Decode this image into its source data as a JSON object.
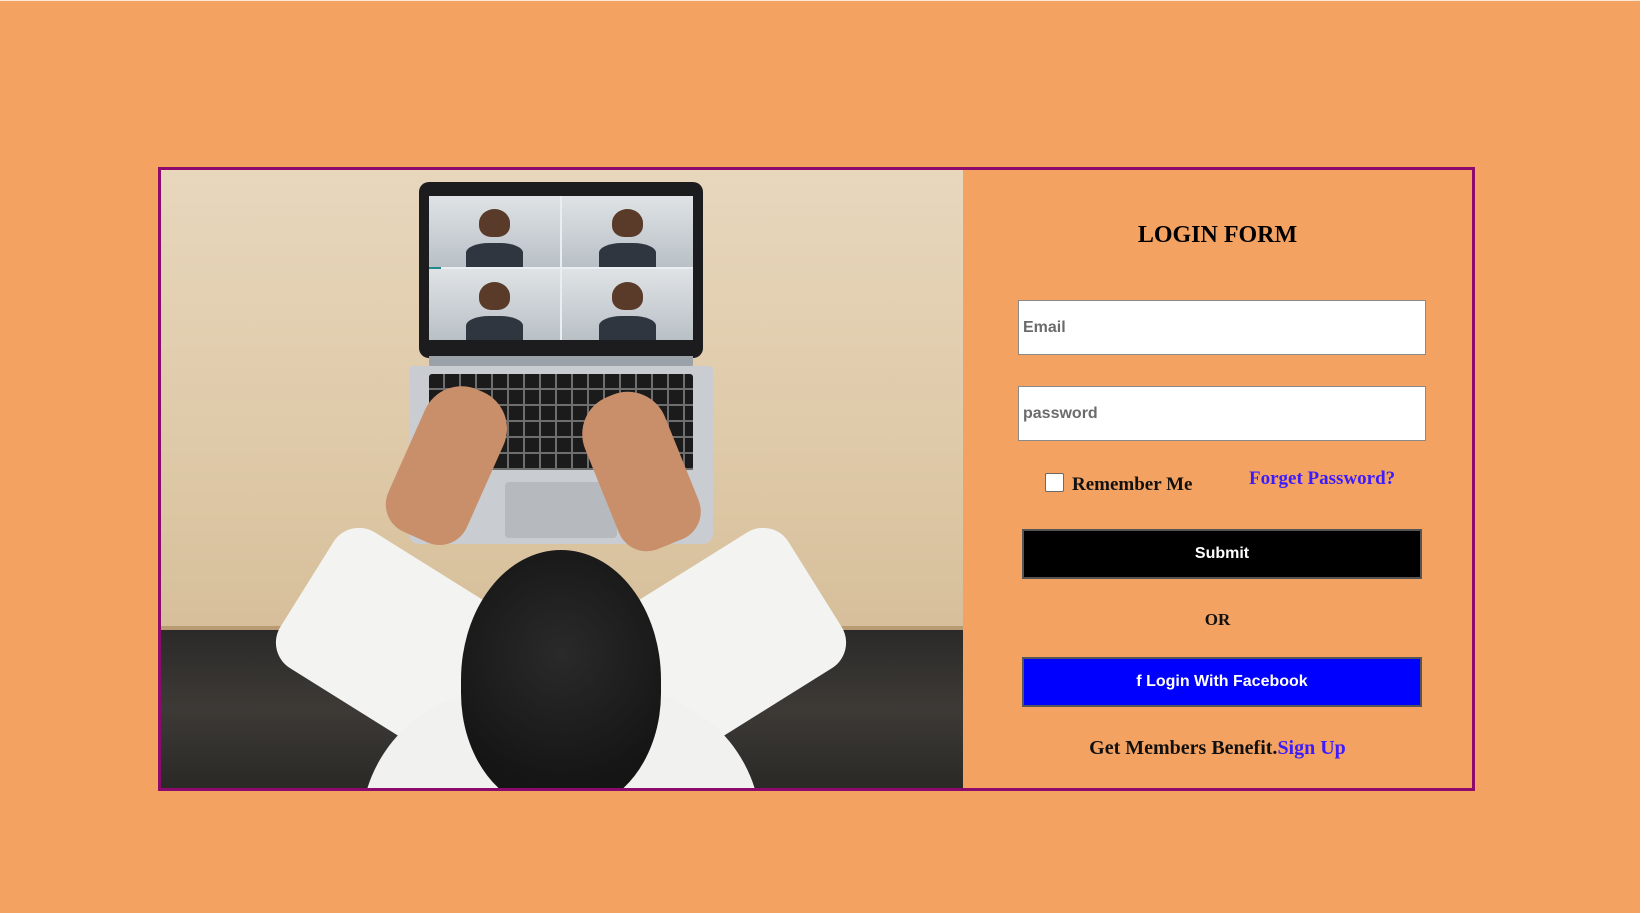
{
  "form": {
    "title": "LOGIN FORM",
    "email_placeholder": "Email",
    "password_placeholder": "password",
    "remember_label": "Remember Me",
    "remember_checked": false,
    "forget_label": "Forget Password?",
    "submit_label": "Submit",
    "or_label": "OR",
    "facebook_label": "f Login With Facebook",
    "members_text": "Get Members Benefit.",
    "signup_label": "Sign Up"
  },
  "colors": {
    "page_background": "#f4a261",
    "card_border": "#8b0a6b",
    "submit_button": "#000000",
    "facebook_button": "#0000ff",
    "link": "#3b1cff"
  },
  "image": {
    "subject": "laptop-video-call-photo"
  }
}
